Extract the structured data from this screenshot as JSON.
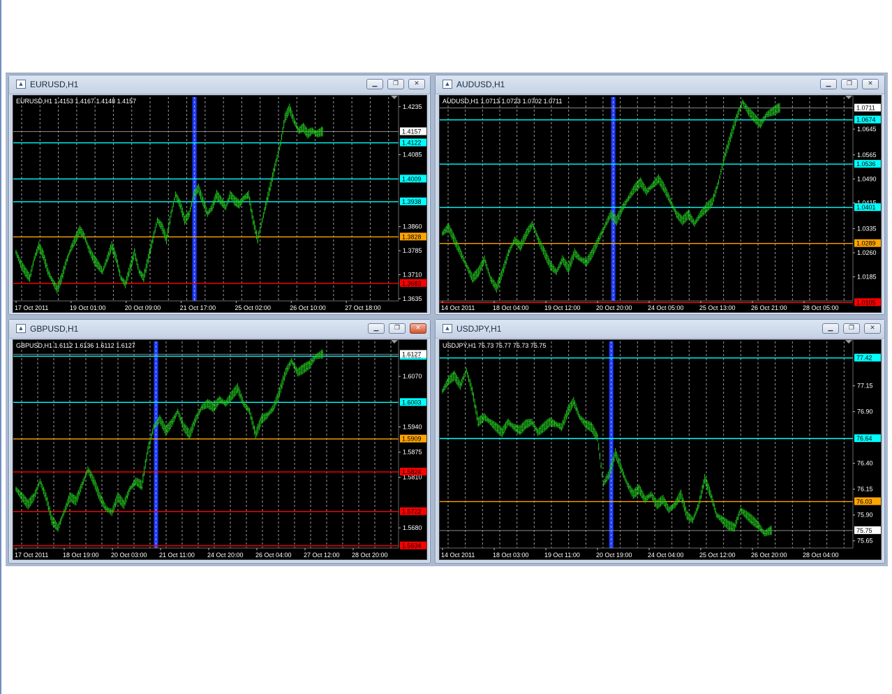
{
  "charts": [
    {
      "id": "eurusd",
      "symbol": "EURUSD,H1",
      "info": "EURUSD,H1  1.4153 1.4167 1.4148 1.4157",
      "close_active": false,
      "price_min": 1.3628,
      "price_max": 1.4265,
      "price_ticks": [
        "1.4235",
        "1.4085",
        "1.3860",
        "1.3785",
        "1.3710",
        "1.3635"
      ],
      "time_labels": [
        "17 Oct 2011",
        "19 Oct 01:00",
        "20 Oct 09:00",
        "21 Oct 17:00",
        "25 Oct 02:00",
        "26 Oct 10:00",
        "27 Oct 18:00"
      ],
      "current_price": "1.4157",
      "levels": [
        {
          "price": "1.4122",
          "color": "#00ffff"
        },
        {
          "price": "1.4009",
          "color": "#00ffff"
        },
        {
          "price": "1.3938",
          "color": "#00ffff"
        },
        {
          "price": "1.3828",
          "color": "#ffa500"
        },
        {
          "price": "1.3683",
          "color": "#ff0000"
        }
      ],
      "series": [
        1.378,
        1.3745,
        1.372,
        1.37,
        1.376,
        1.38,
        1.377,
        1.372,
        1.369,
        1.3665,
        1.37,
        1.375,
        1.379,
        1.382,
        1.385,
        1.383,
        1.379,
        1.376,
        1.374,
        1.372,
        1.376,
        1.38,
        1.376,
        1.37,
        1.368,
        1.373,
        1.378,
        1.372,
        1.37,
        1.376,
        1.382,
        1.388,
        1.386,
        1.382,
        1.39,
        1.396,
        1.393,
        1.388,
        1.39,
        1.396,
        1.398,
        1.394,
        1.39,
        1.392,
        1.396,
        1.394,
        1.392,
        1.396,
        1.394,
        1.393,
        1.395,
        1.396,
        1.388,
        1.382,
        1.388,
        1.394,
        1.4,
        1.406,
        1.412,
        1.42,
        1.423,
        1.419,
        1.416,
        1.417,
        1.415,
        1.416,
        1.415,
        1.4157
      ],
      "blue_marker": 0.465
    },
    {
      "id": "audusd",
      "symbol": "AUDUSD,H1",
      "info": "AUDUSD,H1  1.0713 1.0723 1.0702 1.0711",
      "close_active": false,
      "price_min": 1.011,
      "price_max": 1.0745,
      "price_ticks": [
        "1.0645",
        "1.0565",
        "1.0490",
        "1.0415",
        "1.0335",
        "1.0260",
        "1.0185"
      ],
      "time_labels": [
        "14 Oct 2011",
        "18 Oct 04:00",
        "19 Oct 12:00",
        "20 Oct 20:00",
        "24 Oct 05:00",
        "25 Oct 13:00",
        "26 Oct 21:00",
        "28 Oct 05:00"
      ],
      "current_price": "1.0711",
      "levels": [
        {
          "price": "1.0674",
          "color": "#00ffff"
        },
        {
          "price": "1.0536",
          "color": "#00ffff"
        },
        {
          "price": "1.0401",
          "color": "#00ffff"
        },
        {
          "price": "1.0289",
          "color": "#ffa500"
        },
        {
          "price": "1.0105",
          "color": "#ff0000"
        }
      ],
      "series": [
        1.032,
        1.034,
        1.03,
        1.026,
        1.022,
        1.018,
        1.02,
        1.024,
        1.018,
        1.015,
        1.02,
        1.026,
        1.03,
        1.028,
        1.032,
        1.035,
        1.03,
        1.026,
        1.022,
        1.02,
        1.024,
        1.021,
        1.026,
        1.024,
        1.023,
        1.026,
        1.03,
        1.034,
        1.038,
        1.036,
        1.04,
        1.043,
        1.046,
        1.048,
        1.045,
        1.047,
        1.049,
        1.046,
        1.042,
        1.038,
        1.036,
        1.038,
        1.035,
        1.038,
        1.04,
        1.042,
        1.048,
        1.056,
        1.062,
        1.068,
        1.073,
        1.07,
        1.068,
        1.066,
        1.069,
        1.07,
        1.0711
      ],
      "blue_marker": 0.415
    },
    {
      "id": "gbpusd",
      "symbol": "GBPUSD,H1",
      "info": "GBPUSD,H1  1.6112 1.6136 1.6112 1.6127",
      "close_active": true,
      "price_min": 1.5628,
      "price_max": 1.616,
      "price_ticks": [
        "1.6070",
        "1.5940",
        "1.5875",
        "1.5810",
        "1.5680"
      ],
      "time_labels": [
        "17 Oct 2011",
        "18 Oct 19:00",
        "20 Oct 03:00",
        "21 Oct 11:00",
        "24 Oct 20:00",
        "26 Oct 04:00",
        "27 Oct 12:00",
        "28 Oct 20:00"
      ],
      "current_price": "1.6127",
      "levels": [
        {
          "price": "1.6122",
          "color": "#00ffff"
        },
        {
          "price": "1.6003",
          "color": "#00ffff"
        },
        {
          "price": "1.5909",
          "color": "#ffa500"
        },
        {
          "price": "1.5824",
          "color": "#ff0000"
        },
        {
          "price": "1.5722",
          "color": "#ff0000"
        },
        {
          "price": "1.5634",
          "color": "#ff0000"
        }
      ],
      "series": [
        1.578,
        1.576,
        1.574,
        1.576,
        1.58,
        1.576,
        1.57,
        1.568,
        1.572,
        1.576,
        1.575,
        1.579,
        1.583,
        1.58,
        1.576,
        1.573,
        1.572,
        1.576,
        1.574,
        1.578,
        1.58,
        1.579,
        1.588,
        1.594,
        1.596,
        1.593,
        1.595,
        1.598,
        1.594,
        1.592,
        1.596,
        1.599,
        1.6,
        1.599,
        1.601,
        1.6,
        1.602,
        1.604,
        1.6,
        1.598,
        1.592,
        1.596,
        1.597,
        1.599,
        1.603,
        1.608,
        1.611,
        1.608,
        1.609,
        1.61,
        1.612,
        1.6127
      ],
      "blue_marker": 0.365
    },
    {
      "id": "usdjpy",
      "symbol": "USDJPY,H1",
      "info": "USDJPY,H1  75.73 75.77 75.73 75.75",
      "close_active": false,
      "price_min": 75.58,
      "price_max": 77.58,
      "price_ticks": [
        "77.15",
        "76.90",
        "76.40",
        "76.15",
        "75.90",
        "75.65"
      ],
      "time_labels": [
        "14 Oct 2011",
        "18 Oct 03:00",
        "19 Oct 11:00",
        "20 Oct 19:00",
        "24 Oct 04:00",
        "25 Oct 12:00",
        "26 Oct 20:00",
        "28 Oct 04:00"
      ],
      "current_price": "75.75",
      "levels": [
        {
          "price": "77.42",
          "color": "#00ffff"
        },
        {
          "price": "76.64",
          "color": "#00ffff"
        },
        {
          "price": "76.03",
          "color": "#ffa500"
        }
      ],
      "series": [
        77.1,
        77.2,
        77.25,
        77.15,
        77.3,
        77.1,
        76.8,
        76.85,
        76.8,
        76.75,
        76.7,
        76.8,
        76.75,
        76.72,
        76.78,
        76.8,
        76.7,
        76.75,
        76.8,
        76.78,
        76.75,
        76.9,
        77.0,
        76.85,
        76.78,
        76.75,
        76.65,
        76.2,
        76.3,
        76.5,
        76.35,
        76.2,
        76.1,
        76.15,
        76.05,
        76.1,
        76.0,
        76.05,
        75.95,
        76.0,
        76.1,
        75.9,
        75.85,
        76.0,
        76.25,
        76.1,
        75.9,
        75.85,
        75.8,
        75.78,
        75.95,
        75.9,
        75.85,
        75.8,
        75.72,
        75.75
      ],
      "blue_marker": 0.41
    }
  ]
}
